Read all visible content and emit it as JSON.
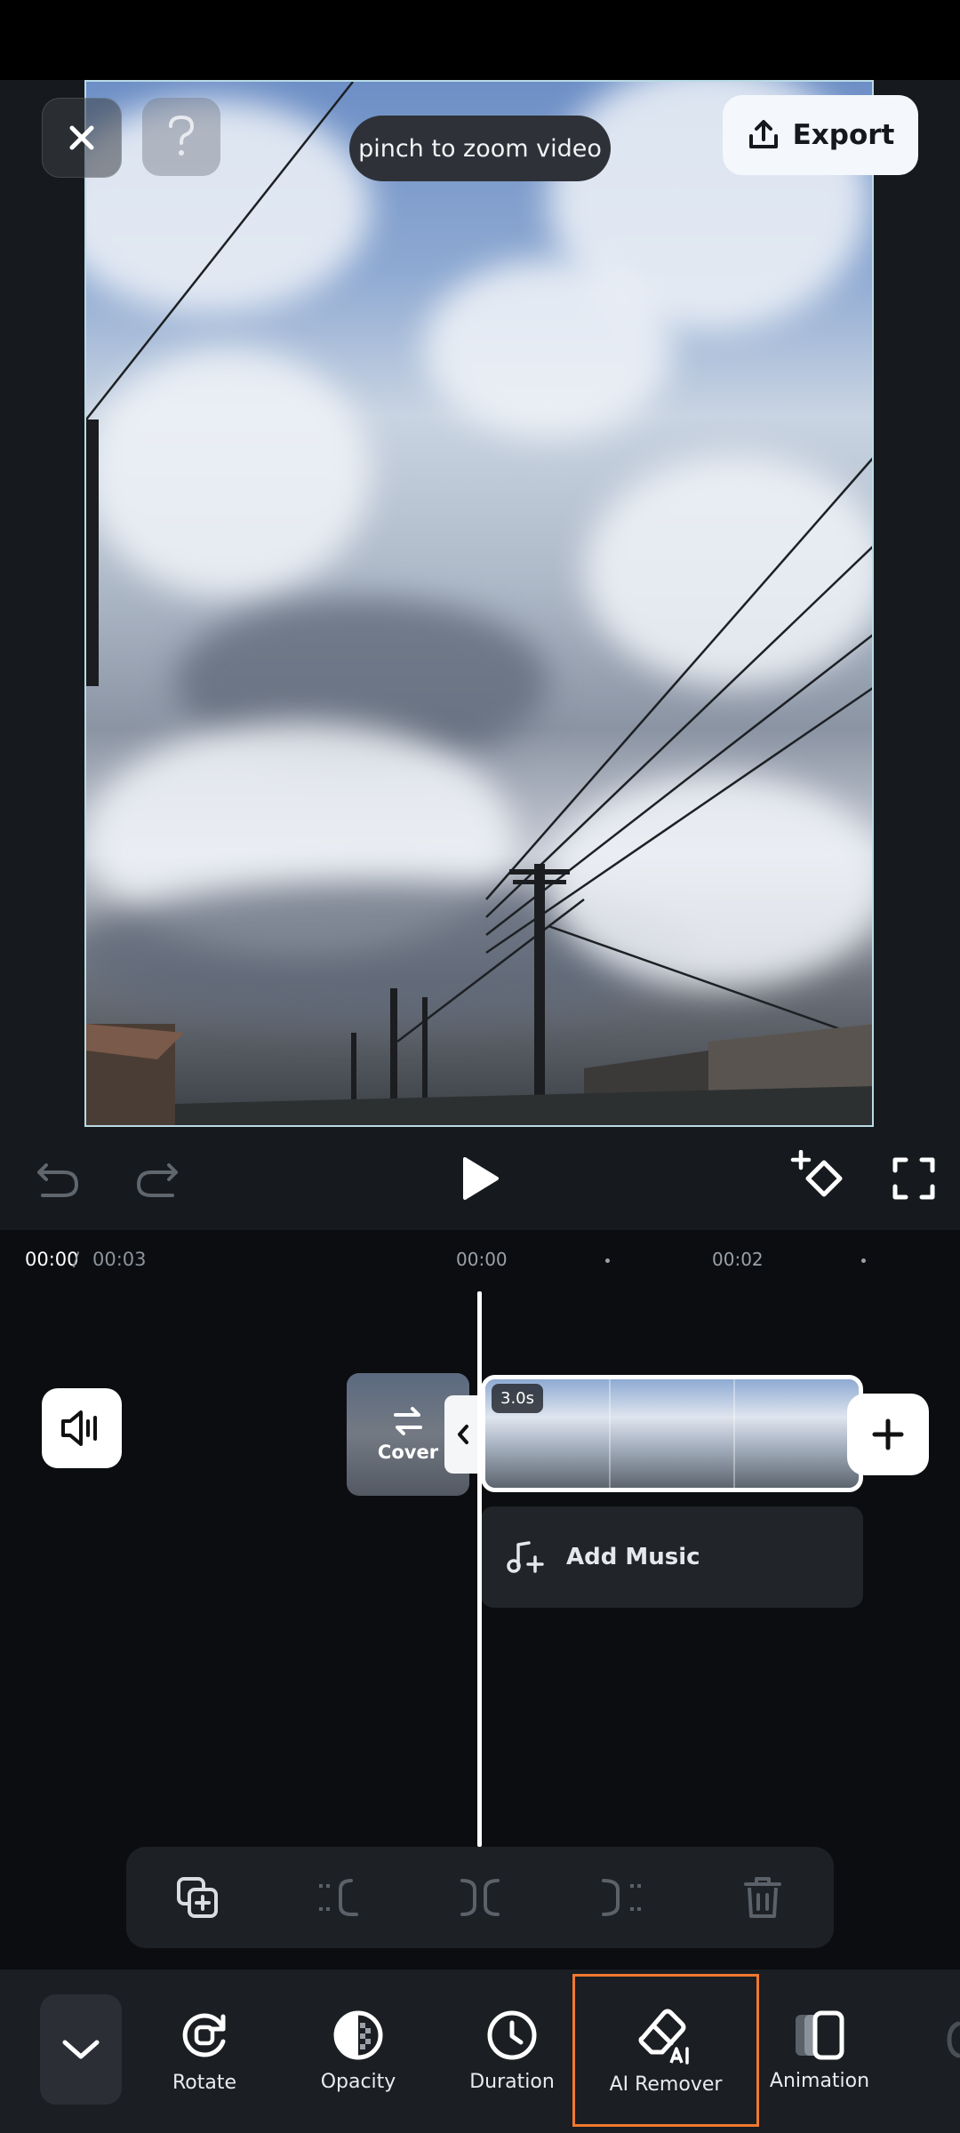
{
  "header": {
    "zoom_hint": "pinch to zoom video",
    "export_label": "Export"
  },
  "playback": {
    "current_time": "00:00",
    "separator": " / ",
    "total_time": "00:03"
  },
  "ruler": {
    "labels": [
      "00:00",
      "00:02"
    ]
  },
  "timeline": {
    "cover_label": "Cover",
    "clip_duration": "3.0s",
    "add_music_label": "Add Music"
  },
  "tools": [
    {
      "label": "Rotate",
      "icon": "rotate-icon"
    },
    {
      "label": "Opacity",
      "icon": "opacity-icon"
    },
    {
      "label": "Duration",
      "icon": "clock-icon"
    },
    {
      "label": "AI Remover",
      "icon": "ai-eraser-icon"
    },
    {
      "label": "Animation",
      "icon": "animation-icon"
    }
  ],
  "colors": {
    "accent_highlight": "#f0792f",
    "preview_border": "#b9dbe6",
    "background": "#16191d"
  }
}
